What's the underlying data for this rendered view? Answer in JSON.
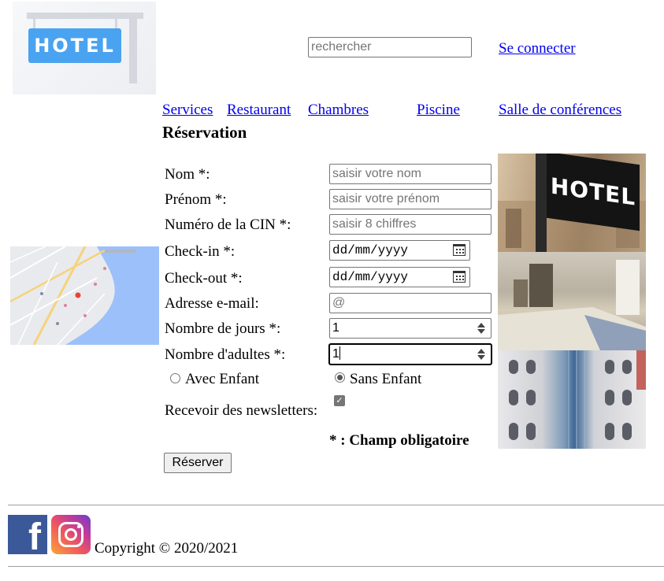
{
  "header": {
    "logo_text": "HOTEL",
    "search_placeholder": "rechercher",
    "login_link": "Se connecter"
  },
  "nav": {
    "items": [
      "Services",
      "Restaurant",
      "Chambres",
      "Piscine",
      "Salle de conférences"
    ]
  },
  "page_title": "Réservation",
  "form": {
    "name": {
      "label": "Nom *:",
      "placeholder": "saisir votre nom"
    },
    "firstname": {
      "label": "Prénom *:",
      "placeholder": "saisir votre prénom"
    },
    "cin": {
      "label": "Numéro de la CIN *:",
      "placeholder": "saisir 8 chiffres"
    },
    "checkin": {
      "label": "Check-in *:",
      "value": "dd/mm/yyyy"
    },
    "checkout": {
      "label": "Check-out *:",
      "value": "dd/mm/yyyy"
    },
    "email": {
      "label": "Adresse e-mail:",
      "placeholder": "@"
    },
    "days": {
      "label": "Nombre de jours *:",
      "value": "1"
    },
    "adults": {
      "label": "Nombre d'adultes *:",
      "value": "1"
    },
    "child_option_1": {
      "label": "Avec Enfant",
      "checked": false
    },
    "child_option_2": {
      "label": "Sans Enfant",
      "checked": true
    },
    "newsletter": {
      "label": "Recevoir des newsletters:",
      "checked": true
    },
    "required_note": "* : Champ obligatoire",
    "submit_label": "Réserver"
  },
  "photos": {
    "photo1_sign_text": "HOTEL"
  },
  "footer": {
    "facebook_glyph": "f",
    "copyright": "Copyright © 2020/2021"
  }
}
